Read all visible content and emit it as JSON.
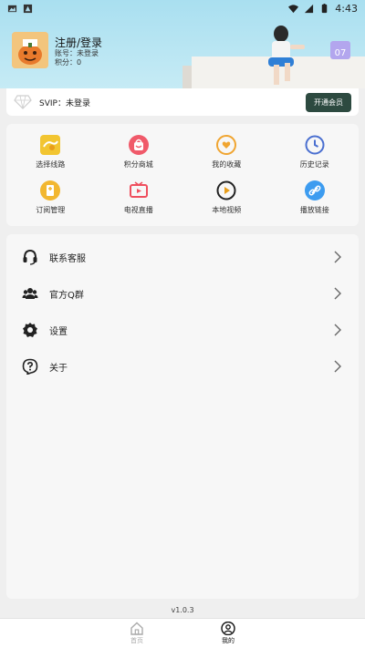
{
  "status_bar": {
    "time": "4:43"
  },
  "profile": {
    "title": "注册/登录",
    "account": "账号：未登录",
    "points": "积分：0",
    "calendar_day": "07"
  },
  "svip": {
    "label": "SVIP：未登录",
    "button": "开通会员"
  },
  "grid": [
    {
      "label": "选择线路",
      "icon": "route-icon",
      "color": "#f2c531"
    },
    {
      "label": "积分商城",
      "icon": "shopping-bag-icon",
      "color": "#f05a6a"
    },
    {
      "label": "我的收藏",
      "icon": "heart-icon",
      "color": "#f0a531"
    },
    {
      "label": "历史记录",
      "icon": "clock-icon",
      "color": "#4a6fd0"
    },
    {
      "label": "订阅管理",
      "icon": "bookmark-icon",
      "color": "#f2b731"
    },
    {
      "label": "电视直播",
      "icon": "tv-icon",
      "color": "#ef4f5e"
    },
    {
      "label": "本地视频",
      "icon": "play-icon",
      "color": "#222222"
    },
    {
      "label": "播放链接",
      "icon": "link-icon",
      "color": "#3d9cf0"
    }
  ],
  "menu": [
    {
      "label": "联系客服",
      "icon": "headset-icon"
    },
    {
      "label": "官方Q群",
      "icon": "group-icon"
    },
    {
      "label": "设置",
      "icon": "gear-icon"
    },
    {
      "label": "关于",
      "icon": "help-icon"
    }
  ],
  "version": "v1.0.3",
  "nav": {
    "home": "首页",
    "mine": "我的"
  }
}
